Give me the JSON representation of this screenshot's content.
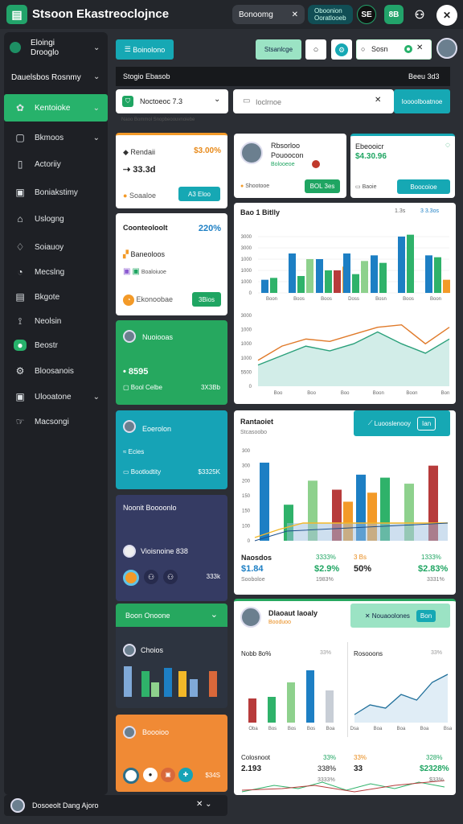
{
  "app": {
    "title": "Stsoon Ekastreoclojnce"
  },
  "topbar": {
    "pill1": "Bonoomg",
    "pill1_x": "✕",
    "pill2_line1": "Oboonion",
    "pill2_line2": "Ooratlooeb",
    "pill2_x": "✕",
    "btn_dark": "SE",
    "btn_green": "8B",
    "user_icon": "user-icon",
    "close_icon": "close-icon"
  },
  "sidebar": {
    "header_line1": "Eloingi",
    "header_line2": "Drooglo",
    "section": "Dauelsbos Rosnmy",
    "items": [
      {
        "label": "Kentoioke",
        "icon": "settings-icon"
      },
      {
        "label": "Bkmoos",
        "icon": "box-icon"
      },
      {
        "label": "Actoriiy",
        "icon": "file-icon"
      },
      {
        "label": "Boniakstimy",
        "icon": "panel-icon"
      },
      {
        "label": "Uslogng",
        "icon": "home-icon"
      },
      {
        "label": "Soiauoy",
        "icon": "bell-icon"
      },
      {
        "label": "Mecslng",
        "icon": "clock-icon"
      },
      {
        "label": "Bkgote",
        "icon": "grid-icon"
      },
      {
        "label": "Neolsin",
        "icon": "leaf-icon"
      },
      {
        "label": "Beostr",
        "icon": "chat-icon"
      },
      {
        "label": "Bloosanois",
        "icon": "gear-icon"
      },
      {
        "label": "Ulooatone",
        "icon": "doc-icon"
      },
      {
        "label": "Macsongi",
        "icon": "hand-icon"
      }
    ],
    "user_name": "Dosoeolt Dang Ajoro"
  },
  "toolbar": {
    "new_button": "Boinolono",
    "filter_button": "Stsanlcge",
    "search_value": "Sosn",
    "dark_label": "Stogio Ebasob",
    "dark_right": "Beeu 3d3"
  },
  "filters": {
    "select_value": "Noctoeoc 7.3",
    "search_value": "Ioclrnoe",
    "apply_button": "Ioooolboatnoe",
    "hint": "Naoo Bommol Snopbeoouvnoiebe"
  },
  "leftcards": {
    "c1": {
      "title": "Rendaii",
      "pct": "$3.00%",
      "value": "33.3d",
      "status": "Soaaloe",
      "button": "A3 Eloo"
    },
    "c2": {
      "title": "Coonteoloolt",
      "pct": "220%",
      "sub1": "Baneoloos",
      "sub2": "Boaloiuoe",
      "status": "Ekonoobae",
      "button": "3Bios"
    },
    "c3": {
      "title": "Nuoiooas",
      "value": "8595",
      "status": "Bool Celbe",
      "extra": "3X3Bb"
    },
    "c4": {
      "title": "Eoerolon",
      "sub": "Ecies",
      "status": "Bootlodtity",
      "extra": "$3325K"
    },
    "c5": {
      "title": "Noonit Boooonlo",
      "sub": "Vioisnoine 838",
      "extra": "333k"
    },
    "c6": {
      "title": "Boon Onoone",
      "sub": "Choios"
    },
    "c7": {
      "title": "Boooioo",
      "extra": "$34S"
    }
  },
  "card_profile": {
    "name_line1": "Rbsorloo",
    "name_line2": "Pouoocon",
    "sub": "Bolooeoe",
    "status": "Shootooe",
    "button": "BOL 3es"
  },
  "card_stat": {
    "title": "Ebeooicr",
    "value": "$4.30.96",
    "status": "Baoie",
    "button": "Boocoioe"
  },
  "chart1": {
    "title": "Bao 1 Bitlly",
    "right1": "1.3s",
    "right2": "3 3.3os"
  },
  "chart2": {
    "title": "Rantaoiet",
    "subtitle": "Stcasoobo",
    "badge": "Luooslenooy",
    "badge_btn": "Ian"
  },
  "stats": {
    "a_label": "Naosdos",
    "a_value": "$1.84",
    "a_sub": "Sooboloe",
    "b_value": "3333%",
    "b_value2": "$2.9%",
    "b_sub": "1983%",
    "c_value": "3 Bs",
    "c_value2": "50%",
    "d_value": "1333%",
    "d_value2": "$2.83%",
    "d_sub": "3331%"
  },
  "bottom": {
    "name": "Dlaoaut laoaly",
    "sub": "Booduoo",
    "badge": "Nouaoolones",
    "badge_btn": "Bon",
    "chart_a_title": "Nobb 8o%",
    "chart_a_right": "33%",
    "chart_b_title": "Rosooons",
    "chart_b_right": "33%",
    "s1_label": "Colosnoot",
    "s1_value": "2.193",
    "s1_pct": "33%",
    "s1_pct2": "338%",
    "s2_label": "33%",
    "s2_value": "33",
    "s2_pct": "$23%",
    "s2_pct2": "3333%",
    "s3_pct": "328%",
    "s3_pct2": "$2328%",
    "s3_pct3": "$33%"
  },
  "chart_data": [
    {
      "type": "bar",
      "title": "Bao 1 Bitlly",
      "ylim": [
        0,
        3000
      ],
      "yticks": [
        "3000",
        "3000",
        "1000",
        "1000",
        "1000",
        "0"
      ],
      "xticks": [
        "Boon",
        "Boos",
        "Boos",
        "Doss",
        "Bosn",
        "Boos",
        "Boon"
      ],
      "series": [
        {
          "color": "#1d7fc4",
          "values": [
            700,
            2100,
            1800,
            2100,
            2000,
            3000,
            2000
          ]
        },
        {
          "color": "#2fb26a",
          "values": [
            800,
            900,
            1200,
            1000,
            1600,
            3100,
            1900
          ]
        },
        {
          "color": "#b73b3b",
          "values": [
            0,
            0,
            1200,
            0,
            0,
            0,
            0
          ]
        },
        {
          "color": "#8ed18d",
          "values": [
            0,
            1800,
            0,
            1700,
            0,
            0,
            0
          ]
        },
        {
          "color": "#f39a28",
          "values": [
            0,
            0,
            1400,
            0,
            0,
            0,
            700
          ]
        }
      ]
    },
    {
      "type": "area",
      "ylim": [
        0,
        3000
      ],
      "yticks": [
        "3000",
        "1000",
        "1000",
        "1000",
        "5500",
        "0"
      ],
      "xticks": [
        "Boo",
        "Boo",
        "Boo",
        "Boon",
        "Boon",
        "Bon"
      ],
      "series": [
        {
          "color": "#e07a2a",
          "values": [
            1100,
            1700,
            2000,
            1900,
            2200,
            2500,
            2600,
            1800,
            2500
          ]
        },
        {
          "color": "#2aa07a",
          "values": [
            900,
            1300,
            1700,
            1500,
            1800,
            2300,
            1800,
            1400,
            2000
          ]
        }
      ]
    },
    {
      "type": "bar",
      "title": "Rantaoiet",
      "ylim": [
        0,
        300
      ],
      "yticks": [
        "300",
        "300",
        "200",
        "150",
        "150",
        "100",
        "0"
      ],
      "series": [
        {
          "color": "#1d7fc4",
          "values": [
            260,
            0,
            0,
            0,
            220,
            0,
            0,
            0
          ]
        },
        {
          "color": "#2fb26a",
          "values": [
            0,
            120,
            0,
            0,
            0,
            210,
            0,
            0
          ]
        },
        {
          "color": "#8ed18d",
          "values": [
            0,
            0,
            200,
            0,
            0,
            0,
            190,
            0
          ]
        },
        {
          "color": "#b73b3b",
          "values": [
            0,
            0,
            0,
            170,
            0,
            0,
            0,
            250
          ]
        },
        {
          "color": "#f39a28",
          "values": [
            0,
            0,
            0,
            130,
            160,
            0,
            0,
            0
          ]
        }
      ]
    },
    {
      "type": "bar",
      "title": "Nobb 8o%",
      "series": [
        {
          "color": "#b73b3b",
          "values": [
            30,
            0,
            0,
            0,
            0
          ]
        },
        {
          "color": "#2fb26a",
          "values": [
            0,
            32,
            0,
            0,
            0
          ]
        },
        {
          "color": "#8ed18d",
          "values": [
            0,
            0,
            50,
            0,
            0
          ]
        },
        {
          "color": "#1d7fc4",
          "values": [
            0,
            0,
            0,
            65,
            0
          ]
        }
      ]
    },
    {
      "type": "line",
      "title": "Rosooons",
      "series": [
        {
          "color": "#1f6f9a",
          "values": [
            10,
            22,
            18,
            35,
            28,
            50,
            60
          ]
        }
      ]
    }
  ]
}
